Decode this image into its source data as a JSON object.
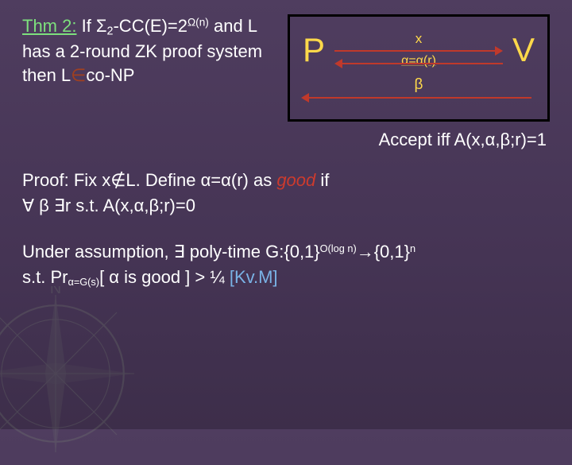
{
  "thm": {
    "label": "Thm 2:",
    "part1": "If Σ",
    "sub1": "2",
    "part2": "-CC(E)=2",
    "sup1": "Ω(n)",
    "part3": "and L has a 2-round ZK proof system then L",
    "in_word": "∈",
    "part4": "co-NP"
  },
  "diagram": {
    "left": "P",
    "right": "V",
    "x": "x",
    "alpha_r": "α=α(r)",
    "beta": "β"
  },
  "accept": "Accept iff A(x,α,β;r)=1",
  "proof": {
    "prefix": "Proof:",
    "line1a": " Fix x∉L. Define α=α(r) as ",
    "good": "good",
    "line1b": " if",
    "line2": "∀ β ∃r s.t. A(x,α,β;r)=0"
  },
  "under": {
    "line1a": "Under assumption, ∃ poly-time G:{0,1}",
    "sup1": "O(log n)",
    "arrow": "→",
    "line1b": "{0,1}",
    "sup2": "n",
    "line2a": "s.t. Pr",
    "sub1": "α=G(s)",
    "line2b": "[ α is good ] > ¼  ",
    "cite": "[Kv.M]"
  }
}
